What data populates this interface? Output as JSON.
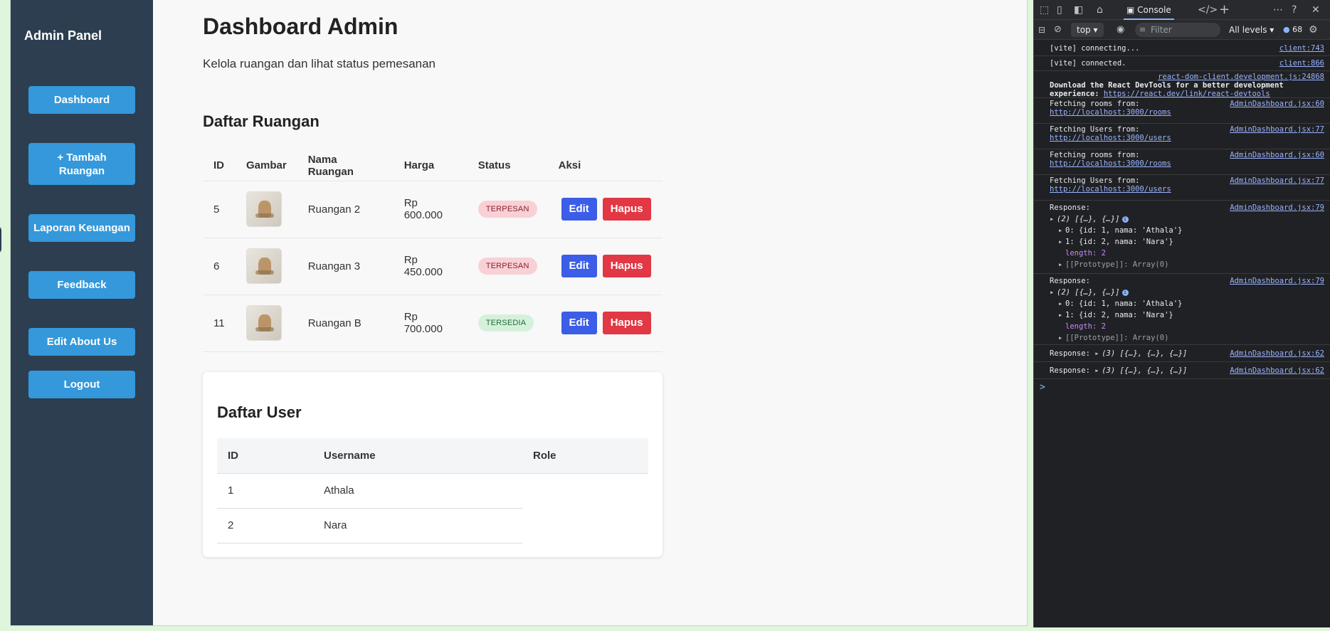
{
  "sidebar": {
    "brand": "Admin Panel",
    "items": [
      {
        "label": "Dashboard"
      },
      {
        "label": "+ Tambah Ruangan"
      },
      {
        "label": "Laporan Keuangan"
      },
      {
        "label": "Feedback"
      },
      {
        "label": "Edit About Us"
      },
      {
        "label": "Logout"
      }
    ]
  },
  "main": {
    "title": "Dashboard Admin",
    "subtitle": "Kelola ruangan dan lihat status pemesanan",
    "rooms_section": {
      "title": "Daftar Ruangan",
      "columns": [
        "ID",
        "Gambar",
        "Nama Ruangan",
        "Harga",
        "Status",
        "Aksi"
      ],
      "rows": [
        {
          "id": "5",
          "name": "Ruangan 2",
          "price": "Rp 600.000",
          "status": "TERPESAN"
        },
        {
          "id": "6",
          "name": "Ruangan 3",
          "price": "Rp 450.000",
          "status": "TERPESAN"
        },
        {
          "id": "11",
          "name": "Ruangan B",
          "price": "Rp 700.000",
          "status": "TERSEDIA"
        }
      ],
      "edit_label": "Edit",
      "delete_label": "Hapus"
    },
    "users_section": {
      "title": "Daftar User",
      "columns": [
        "ID",
        "Username",
        "Role"
      ],
      "rows": [
        {
          "id": "1",
          "username": "Athala"
        },
        {
          "id": "2",
          "username": "Nara"
        }
      ]
    }
  },
  "devtools": {
    "tab": "Console",
    "context": "top",
    "filter_placeholder": "Filter",
    "levels": "All levels",
    "issue_count": "68",
    "prompt": ">",
    "logs": {
      "l1": {
        "text": "[vite] connecting...",
        "src": "client:743"
      },
      "l2": {
        "text": "[vite] connected.",
        "src": "client:866"
      },
      "l3": {
        "src": "react-dom-client.development.js:24868",
        "text": "Download the React DevTools for a better development experience: ",
        "link": "https://react.dev/link/react-devtools"
      },
      "l4": {
        "text": "Fetching rooms from:",
        "link": "http://localhost:3000/rooms",
        "src": "AdminDashboard.jsx:60"
      },
      "l5": {
        "text": "Fetching Users from:",
        "link": "http://localhost:3000/users",
        "src": "AdminDashboard.jsx:77"
      },
      "l6": {
        "text": "Fetching rooms from:",
        "link": "http://localhost:3000/rooms",
        "src": "AdminDashboard.jsx:60"
      },
      "l7": {
        "text": "Fetching Users from:",
        "link": "http://localhost:3000/users",
        "src": "AdminDashboard.jsx:77"
      },
      "l8": {
        "text": "Response:",
        "src": "AdminDashboard.jsx:79",
        "summary": "(2) [{…}, {…}]",
        "item0": "0: {id: 1, nama: 'Athala'}",
        "item1": "1: {id: 2, nama: 'Nara'}",
        "length": "length: 2",
        "proto": "[[Prototype]]: Array(0)"
      },
      "l9": {
        "text": "Response:",
        "src": "AdminDashboard.jsx:79",
        "summary": "(2) [{…}, {…}]",
        "item0": "0: {id: 1, nama: 'Athala'}",
        "item1": "1: {id: 2, nama: 'Nara'}",
        "length": "length: 2",
        "proto": "[[Prototype]]: Array(0)"
      },
      "l10": {
        "text": "Response:",
        "summary": "(3) [{…}, {…}, {…}]",
        "src": "AdminDashboard.jsx:62"
      },
      "l11": {
        "text": "Response:",
        "summary": "(3) [{…}, {…}, {…}]",
        "src": "AdminDashboard.jsx:62"
      }
    }
  }
}
